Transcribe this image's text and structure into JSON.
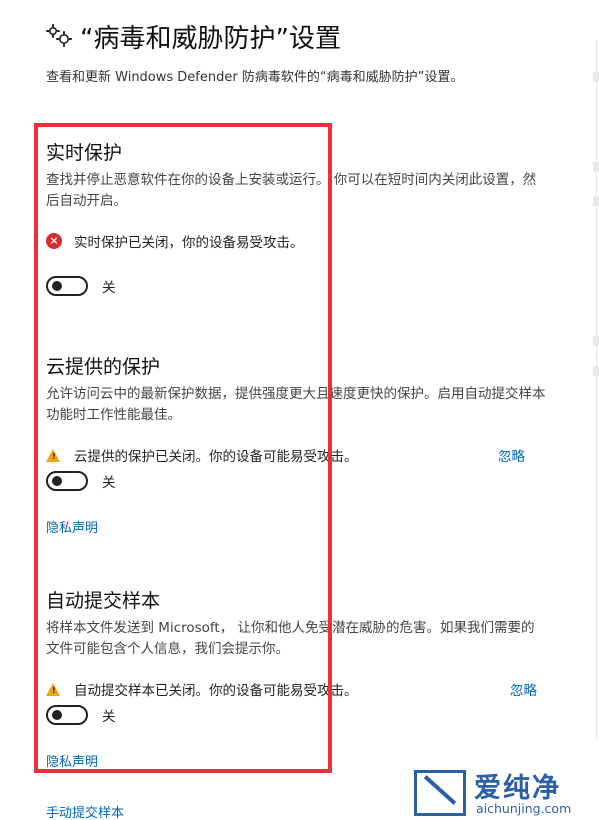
{
  "header": {
    "icon": "gear-icon",
    "title": "“病毒和威胁防护”设置",
    "subtitle": "查看和更新 Windows Defender 防病毒软件的“病毒和威胁防护”设置。"
  },
  "sections": [
    {
      "title": "实时保护",
      "description": "查找并停止恶意软件在你的设备上安装或运行。 你可以在短时间内关闭此设置，然后自动开启。",
      "status": {
        "icon": "error-icon",
        "text": "实时保护已关闭，你的设备易受攻击。"
      },
      "toggle": {
        "state": "off",
        "label": "关"
      }
    },
    {
      "title": "云提供的保护",
      "description": "允许访问云中的最新保护数据，提供强度更大且速度更快的保护。启用自动提交样本功能时工作性能最佳。",
      "status": {
        "icon": "warning-icon",
        "text": "云提供的保护已关闭。你的设备可能易受攻击。"
      },
      "dismiss_label": "忽略",
      "toggle": {
        "state": "off",
        "label": "关"
      },
      "privacy_link": "隐私声明"
    },
    {
      "title": "自动提交样本",
      "description": "将样本文件发送到 Microsoft， 让你和他人免受潜在威胁的危害。如果我们需要的文件可能包含个人信息，我们会提示你。",
      "status": {
        "icon": "warning-icon",
        "text": "自动提交样本已关闭。你的设备可能易受攻击。"
      },
      "dismiss_label": "忽略",
      "toggle": {
        "state": "off",
        "label": "关"
      },
      "privacy_link": "隐私声明"
    }
  ],
  "manual_submit_link": "手动提交样本",
  "watermark": {
    "brand": "爱纯净",
    "url": "aichunjing.com"
  },
  "colors": {
    "link": "#0067b8",
    "error": "#d42e2e",
    "warning": "#f0a30a",
    "highlight_frame": "#e8313b",
    "watermark": "#2b5fa8"
  }
}
